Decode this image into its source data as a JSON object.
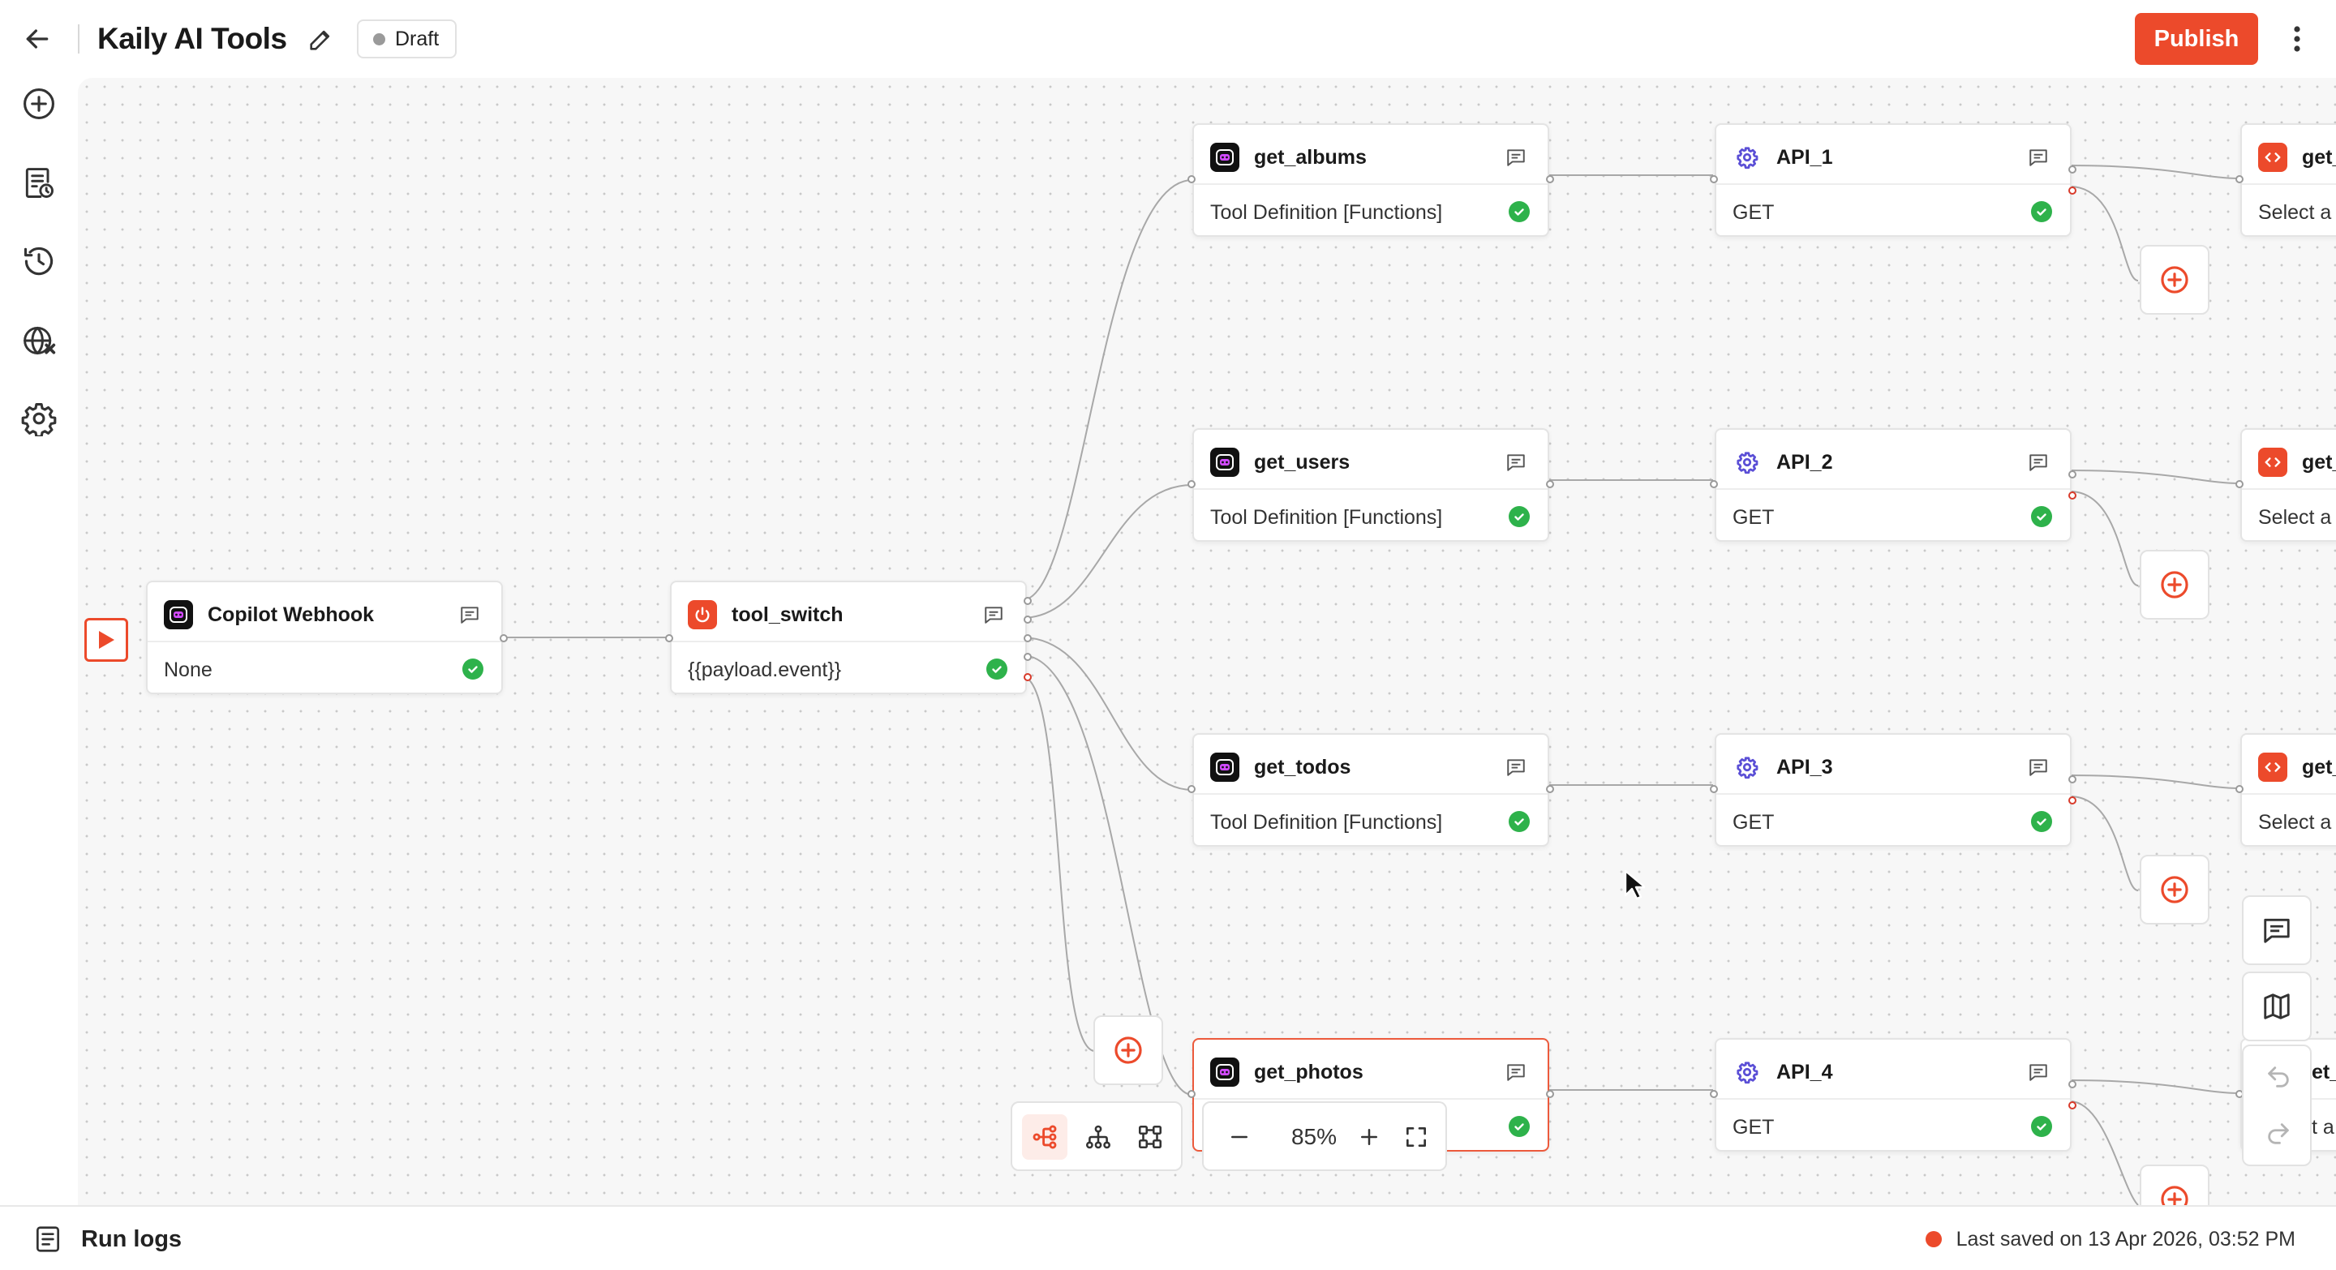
{
  "header": {
    "title": "Kaily AI Tools",
    "status": "Draft",
    "publish_label": "Publish",
    "icons": [
      "arrow-left-icon",
      "pencil-icon",
      "more-vertical-icon"
    ]
  },
  "sidebar": {
    "items": [
      {
        "name": "add",
        "icon": "plus-circle-icon"
      },
      {
        "name": "logs",
        "icon": "document-clock-icon"
      },
      {
        "name": "history",
        "icon": "history-icon"
      },
      {
        "name": "globe",
        "icon": "globe-icon"
      },
      {
        "name": "settings",
        "icon": "gear-icon"
      }
    ]
  },
  "nodes": {
    "webhook": {
      "title": "Copilot Webhook",
      "subtitle": "None"
    },
    "switch": {
      "title": "tool_switch",
      "subtitle": "{{payload.event}}"
    },
    "get_albums": {
      "title": "get_albums",
      "subtitle": "Tool Definition [Functions]"
    },
    "get_users": {
      "title": "get_users",
      "subtitle": "Tool Definition [Functions]"
    },
    "get_todos": {
      "title": "get_todos",
      "subtitle": "Tool Definition [Functions]"
    },
    "get_photos": {
      "title": "get_photos",
      "subtitle": ""
    },
    "api_1": {
      "title": "API_1",
      "subtitle": "GET"
    },
    "api_2": {
      "title": "API_2",
      "subtitle": "GET"
    },
    "api_3": {
      "title": "API_3",
      "subtitle": "GET"
    },
    "api_4": {
      "title": "API_4",
      "subtitle": "GET"
    },
    "partial_1": {
      "title": "get_",
      "subtitle": "Select a"
    },
    "partial_2": {
      "title": "get_",
      "subtitle": "Select a"
    },
    "partial_3": {
      "title": "get_",
      "subtitle": "Select a"
    },
    "partial_4": {
      "title": "et_",
      "subtitle": "t a"
    }
  },
  "zoom": {
    "level": "85%"
  },
  "footer": {
    "run_logs_label": "Run logs",
    "saved_text": "Last saved on 13 Apr 2026, 03:52 PM"
  },
  "colors": {
    "accent": "#ec4a2b",
    "success": "#2eb24b",
    "node_border": "#e4e4e4",
    "canvas_bg": "#f7f7f7"
  }
}
